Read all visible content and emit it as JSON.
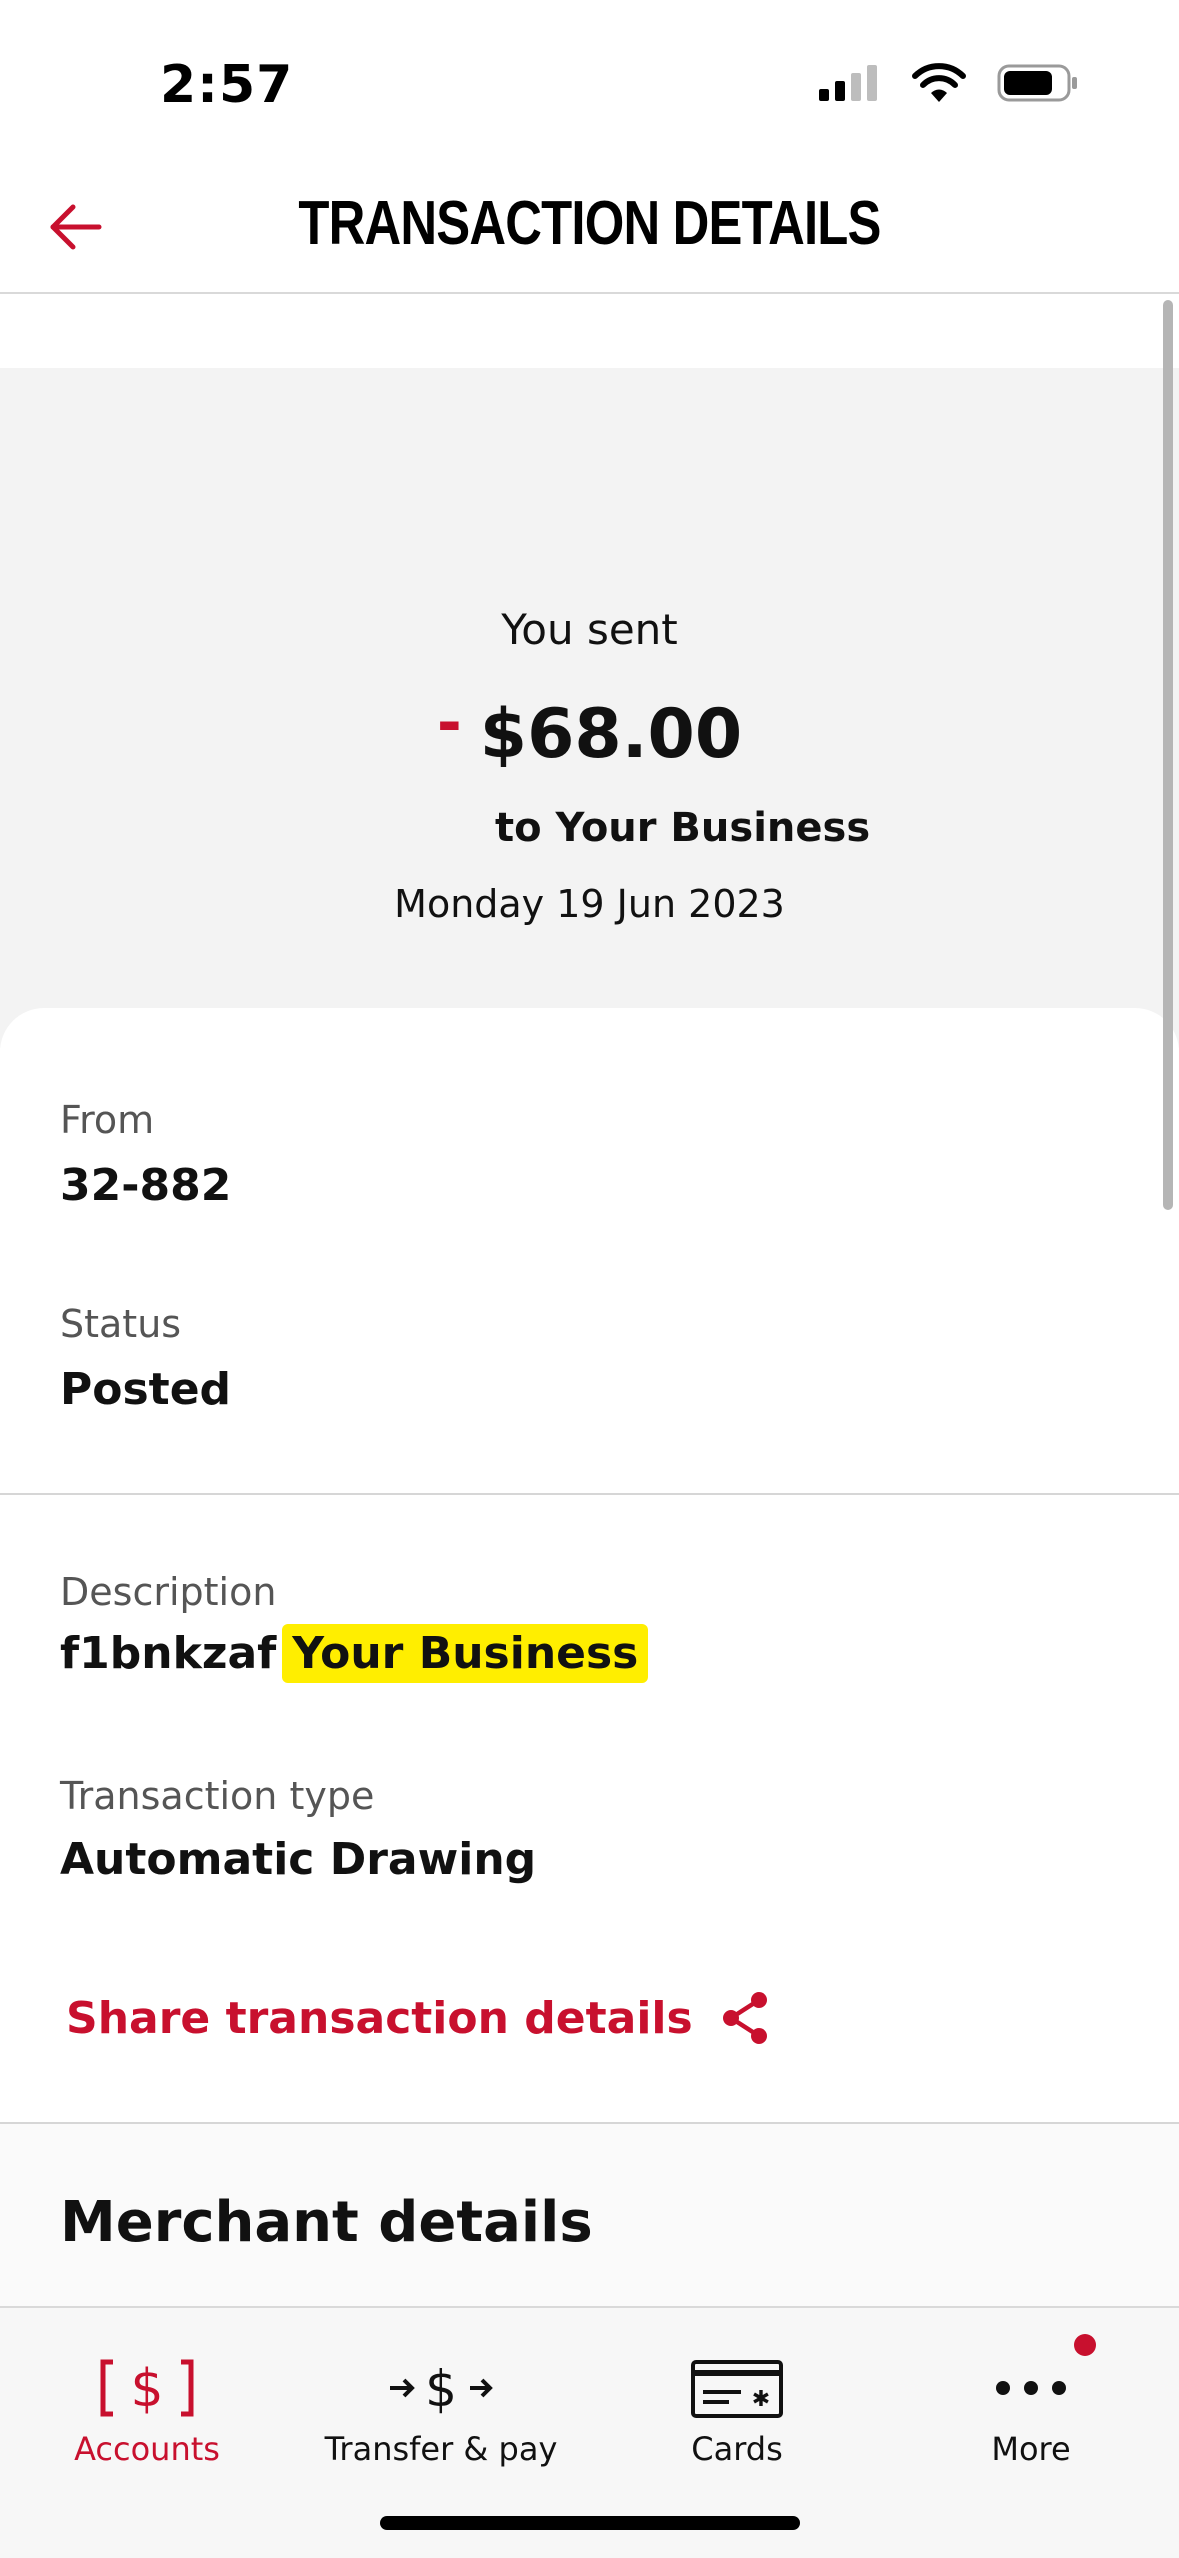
{
  "status_bar": {
    "time": "2:57"
  },
  "header": {
    "title": "TRANSACTION DETAILS",
    "back_icon": "arrow-left-icon",
    "accent_color": "#c8102e"
  },
  "summary": {
    "label": "You sent",
    "sign": "-",
    "amount": "$68.00",
    "recipient": "to Your Business",
    "date": "Monday 19 Jun 2023"
  },
  "details": {
    "from_label": "From",
    "from_value": "32-882",
    "status_label": "Status",
    "status_value": "Posted",
    "description_label": "Description",
    "description_code": "f1bnkzaf",
    "description_highlight": "Your Business",
    "highlight_color": "#ffee00",
    "type_label": "Transaction type",
    "type_value": "Automatic Drawing",
    "share_label": "Share transaction details",
    "share_icon": "share-icon"
  },
  "merchant": {
    "title": "Merchant details"
  },
  "bottom_nav": {
    "items": [
      {
        "label": "Accounts",
        "icon": "accounts-dollar-icon",
        "active": true
      },
      {
        "label": "Transfer & pay",
        "icon": "transfer-icon",
        "active": false
      },
      {
        "label": "Cards",
        "icon": "card-icon",
        "active": false
      },
      {
        "label": "More",
        "icon": "more-dots-icon",
        "active": false,
        "has_notification": true
      }
    ]
  }
}
